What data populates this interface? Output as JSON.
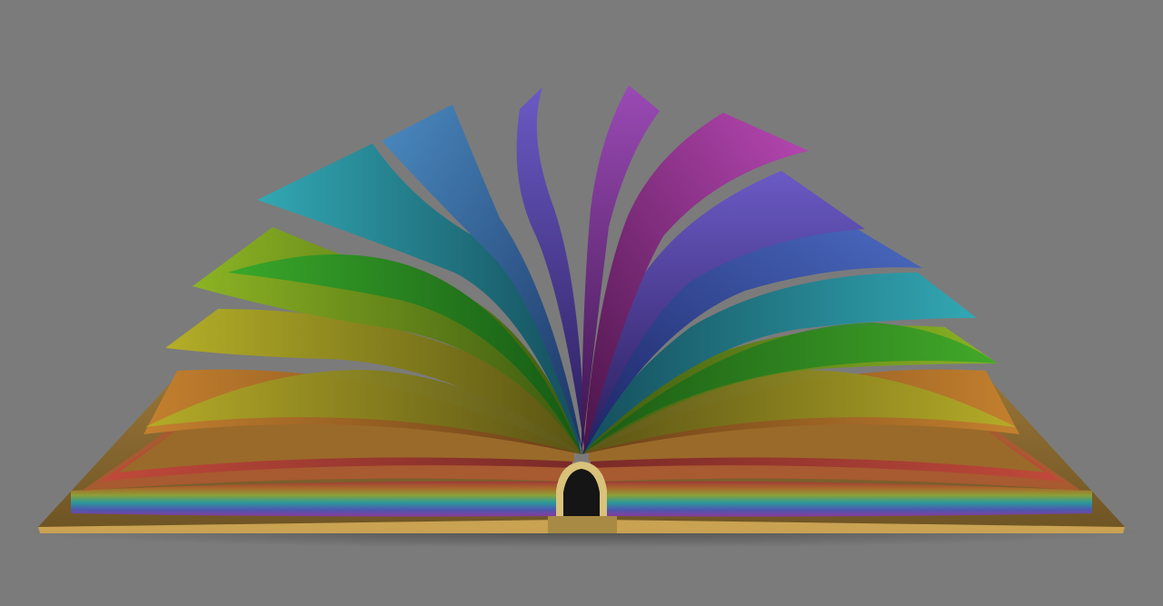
{
  "scene": {
    "subject": "open-book-rainbow-pages-illustration",
    "background_color": "#7b7b7b",
    "cover_color": "#8a6a2e",
    "cover_edge_color": "#c9a252",
    "spine_color": "#1a1a1a",
    "page_colors": {
      "red": "#b8403a",
      "orange": "#b8782e",
      "yellow": "#a7a42a",
      "lime": "#88b020",
      "green": "#35a028",
      "teal": "#2a9aa8",
      "blue": "#3a6fb0",
      "indigo": "#5a4ea8",
      "violet": "#7a3a9a",
      "magenta": "#a03aa0"
    }
  }
}
